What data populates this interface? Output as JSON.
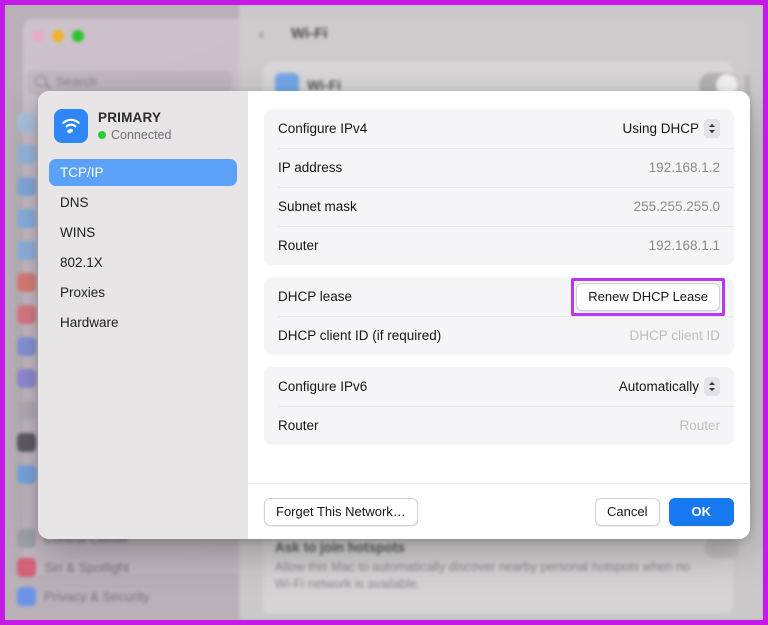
{
  "annotation": {
    "highlight_color": "#b739ee",
    "frame_color": "#c31ae8"
  },
  "background_window": {
    "title": "Wi-Fi",
    "back_chevron": "‹",
    "search_placeholder": "Search",
    "wifi_card_label": "Wi-Fi",
    "sidebar_items": [
      {
        "label": "Control Center",
        "color": "#9aa0a6"
      },
      {
        "label": "Siri & Spotlight",
        "color": "#d85570"
      },
      {
        "label": "Privacy & Security",
        "color": "#5d8ff0"
      }
    ],
    "hotspot": {
      "title": "Ask to join hotspots",
      "description": "Allow this Mac to automatically discover nearby personal hotspots when no Wi-Fi network is available."
    }
  },
  "dialog": {
    "network": {
      "name": "PRIMARY",
      "status": "Connected",
      "status_color": "#29cc35",
      "icon": "wifi-icon"
    },
    "sidebar": {
      "items": [
        {
          "label": "TCP/IP",
          "selected": true
        },
        {
          "label": "DNS",
          "selected": false
        },
        {
          "label": "WINS",
          "selected": false
        },
        {
          "label": "802.1X",
          "selected": false
        },
        {
          "label": "Proxies",
          "selected": false
        },
        {
          "label": "Hardware",
          "selected": false
        }
      ]
    },
    "groups": [
      {
        "name": "ipv4-group",
        "rows": [
          {
            "label": "Configure IPv4",
            "value": "Using DHCP",
            "type": "popup"
          },
          {
            "label": "IP address",
            "value": "192.168.1.2",
            "type": "value"
          },
          {
            "label": "Subnet mask",
            "value": "255.255.255.0",
            "type": "value"
          },
          {
            "label": "Router",
            "value": "192.168.1.1",
            "type": "value"
          }
        ]
      },
      {
        "name": "dhcp-group",
        "rows": [
          {
            "label": "DHCP lease",
            "value": "Renew DHCP Lease",
            "type": "button"
          },
          {
            "label": "DHCP client ID (if required)",
            "value": "DHCP client ID",
            "type": "placeholder"
          }
        ]
      },
      {
        "name": "ipv6-group",
        "rows": [
          {
            "label": "Configure IPv6",
            "value": "Automatically",
            "type": "popup"
          },
          {
            "label": "Router",
            "value": "Router",
            "type": "placeholder"
          }
        ]
      }
    ],
    "footer": {
      "forget_label": "Forget This Network…",
      "cancel_label": "Cancel",
      "ok_label": "OK"
    }
  }
}
